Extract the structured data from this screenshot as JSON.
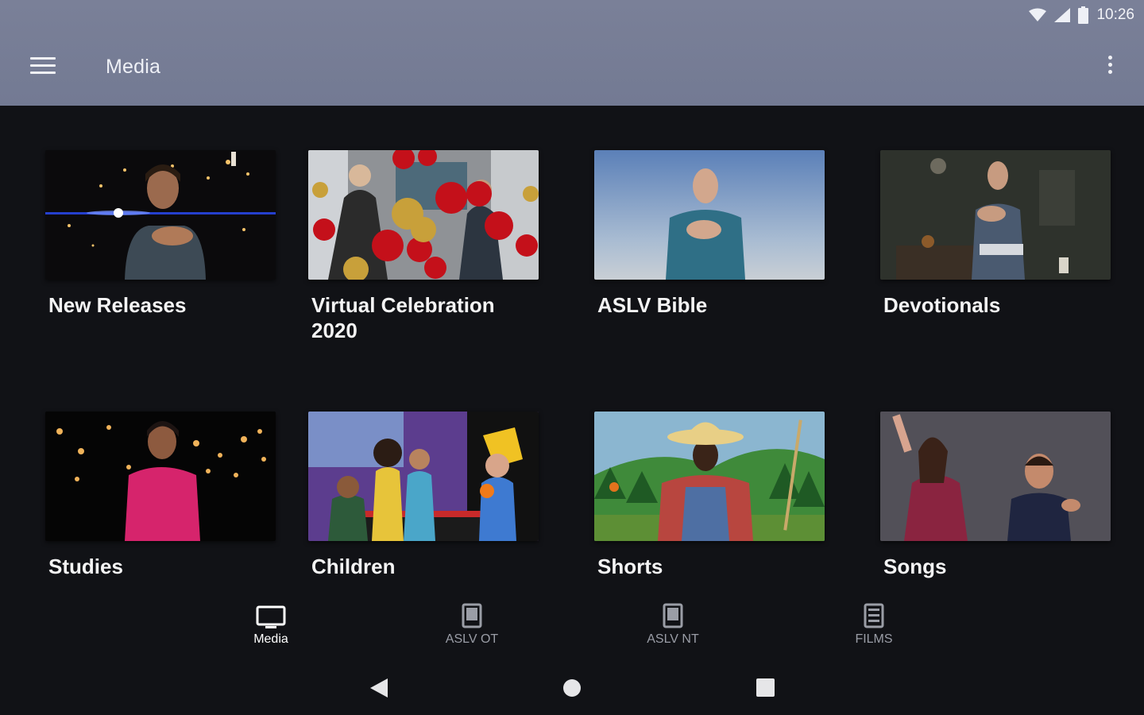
{
  "status_bar": {
    "time": "10:26",
    "icons": [
      "wifi-icon",
      "cell-signal-icon",
      "battery-icon"
    ]
  },
  "app_bar": {
    "title": "Media",
    "menu_icon": "hamburger-menu-icon",
    "overflow_icon": "more-vert-icon",
    "background": "#767d96"
  },
  "categories": [
    {
      "label": "New Releases"
    },
    {
      "label": "Virtual Celebration 2020"
    },
    {
      "label": "ASLV Bible"
    },
    {
      "label": "Devotionals"
    },
    {
      "label": "Studies"
    },
    {
      "label": "Children"
    },
    {
      "label": "Shorts"
    },
    {
      "label": "Songs"
    }
  ],
  "bottom_nav": [
    {
      "label": "Media",
      "icon": "tv-icon",
      "active": true
    },
    {
      "label": "ASLV OT",
      "icon": "book-icon",
      "active": false
    },
    {
      "label": "ASLV NT",
      "icon": "book-icon",
      "active": false
    },
    {
      "label": "FILMS",
      "icon": "film-icon",
      "active": false
    }
  ],
  "system_nav": {
    "icons": [
      "back-triangle-icon",
      "home-circle-icon",
      "recents-square-icon"
    ]
  },
  "colors": {
    "background": "#111216",
    "active_nav": "#ffffff",
    "inactive_nav": "#9a9da6"
  }
}
